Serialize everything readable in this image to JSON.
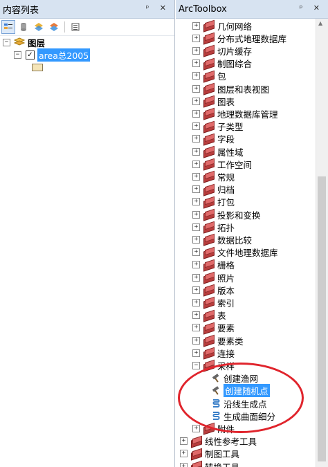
{
  "toc": {
    "title": "内容列表",
    "controls": "ᵖ ✕",
    "toolbar_icons": [
      "list-by-drawing-order-icon",
      "list-by-source-icon",
      "list-by-visibility-icon",
      "list-by-selection-icon",
      "options-icon"
    ],
    "layers_label": "图层",
    "layer_name": "area总2005",
    "layer_checked": true
  },
  "atb": {
    "title": "ArcToolbox",
    "controls": "ᵖ ✕",
    "toolsets": [
      "几何网络",
      "分布式地理数据库",
      "切片缓存",
      "制图综合",
      "包",
      "图层和表视图",
      "图表",
      "地理数据库管理",
      "子类型",
      "字段",
      "属性域",
      "工作空间",
      "常规",
      "归档",
      "打包",
      "投影和变换",
      "拓扑",
      "数据比较",
      "文件地理数据库",
      "栅格",
      "照片",
      "版本",
      "索引",
      "表",
      "要素",
      "要素类",
      "连接"
    ],
    "sampling": {
      "label": "采样",
      "tools": [
        "创建渔网",
        "创建随机点",
        "沿线生成点",
        "生成曲面细分"
      ],
      "selected_index": 1
    },
    "after_toolsets": [
      "附件"
    ],
    "toolboxes": [
      "线性参考工具",
      "制图工具",
      "转换工具"
    ]
  }
}
